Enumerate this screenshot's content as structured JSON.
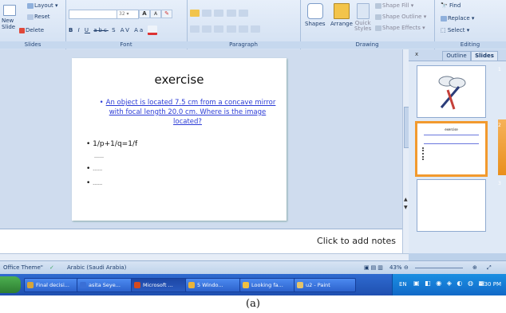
{
  "ribbon": {
    "slides_group": {
      "layout": "Layout",
      "reset": "Reset",
      "new_slide": "New\nSlide",
      "delete": "Delete",
      "label": "Slides"
    },
    "font_group": {
      "font_size": "32",
      "grow": "A",
      "shrink": "A",
      "clear": "†",
      "label": "Font"
    },
    "paragraph_group": {
      "label": "Paragraph"
    },
    "drawing_group": {
      "shapes": "Shapes",
      "arrange": "Arrange",
      "quick_styles": "Quick\nStyles",
      "shape_fill": "Shape Fill",
      "shape_outline": "Shape Outline",
      "shape_effects": "Shape Effects",
      "label": "Drawing"
    },
    "editing_group": {
      "find": "Find",
      "replace": "Replace",
      "select": "Select",
      "label": "Editing"
    }
  },
  "pane": {
    "close": "x",
    "tab_outline": "Outline",
    "tab_slides": "Slides",
    "thumb_numbers": [
      "1",
      "2",
      "3"
    ],
    "thumb2_title": "exercise"
  },
  "slide": {
    "title": "exercise",
    "link_text": "An object is located 7.5 cm from a concave mirror with focal length 20.0 cm. Where is the image located?",
    "bullets": [
      "1/p+1/q=1/f",
      "……",
      "……",
      "……"
    ]
  },
  "notes_placeholder": "Click to add notes",
  "status": {
    "theme": "Office Theme\"",
    "language": "Arabic (Saudi Arabia)",
    "zoom": "43%"
  },
  "taskbar": {
    "items": [
      {
        "label": "Final decisi...",
        "color": "#d6a53a"
      },
      {
        "label": "asita Seye...",
        "color": "#3a6fd6"
      },
      {
        "label": "Microsoft ...",
        "color": "#d64a1f"
      },
      {
        "label": "5 Windo...",
        "color": "#e9b33a"
      },
      {
        "label": "Looking fa...",
        "color": "#f0c040"
      },
      {
        "label": "u2 - Paint",
        "color": "#e4c36a"
      }
    ],
    "lang": "EN",
    "time": "4:30 PM"
  },
  "caption": "(a)",
  "colors": {
    "accent_orange": "#f29a2e",
    "link_blue": "#2b3bd6",
    "taskbar_blue": "#2456c0"
  }
}
